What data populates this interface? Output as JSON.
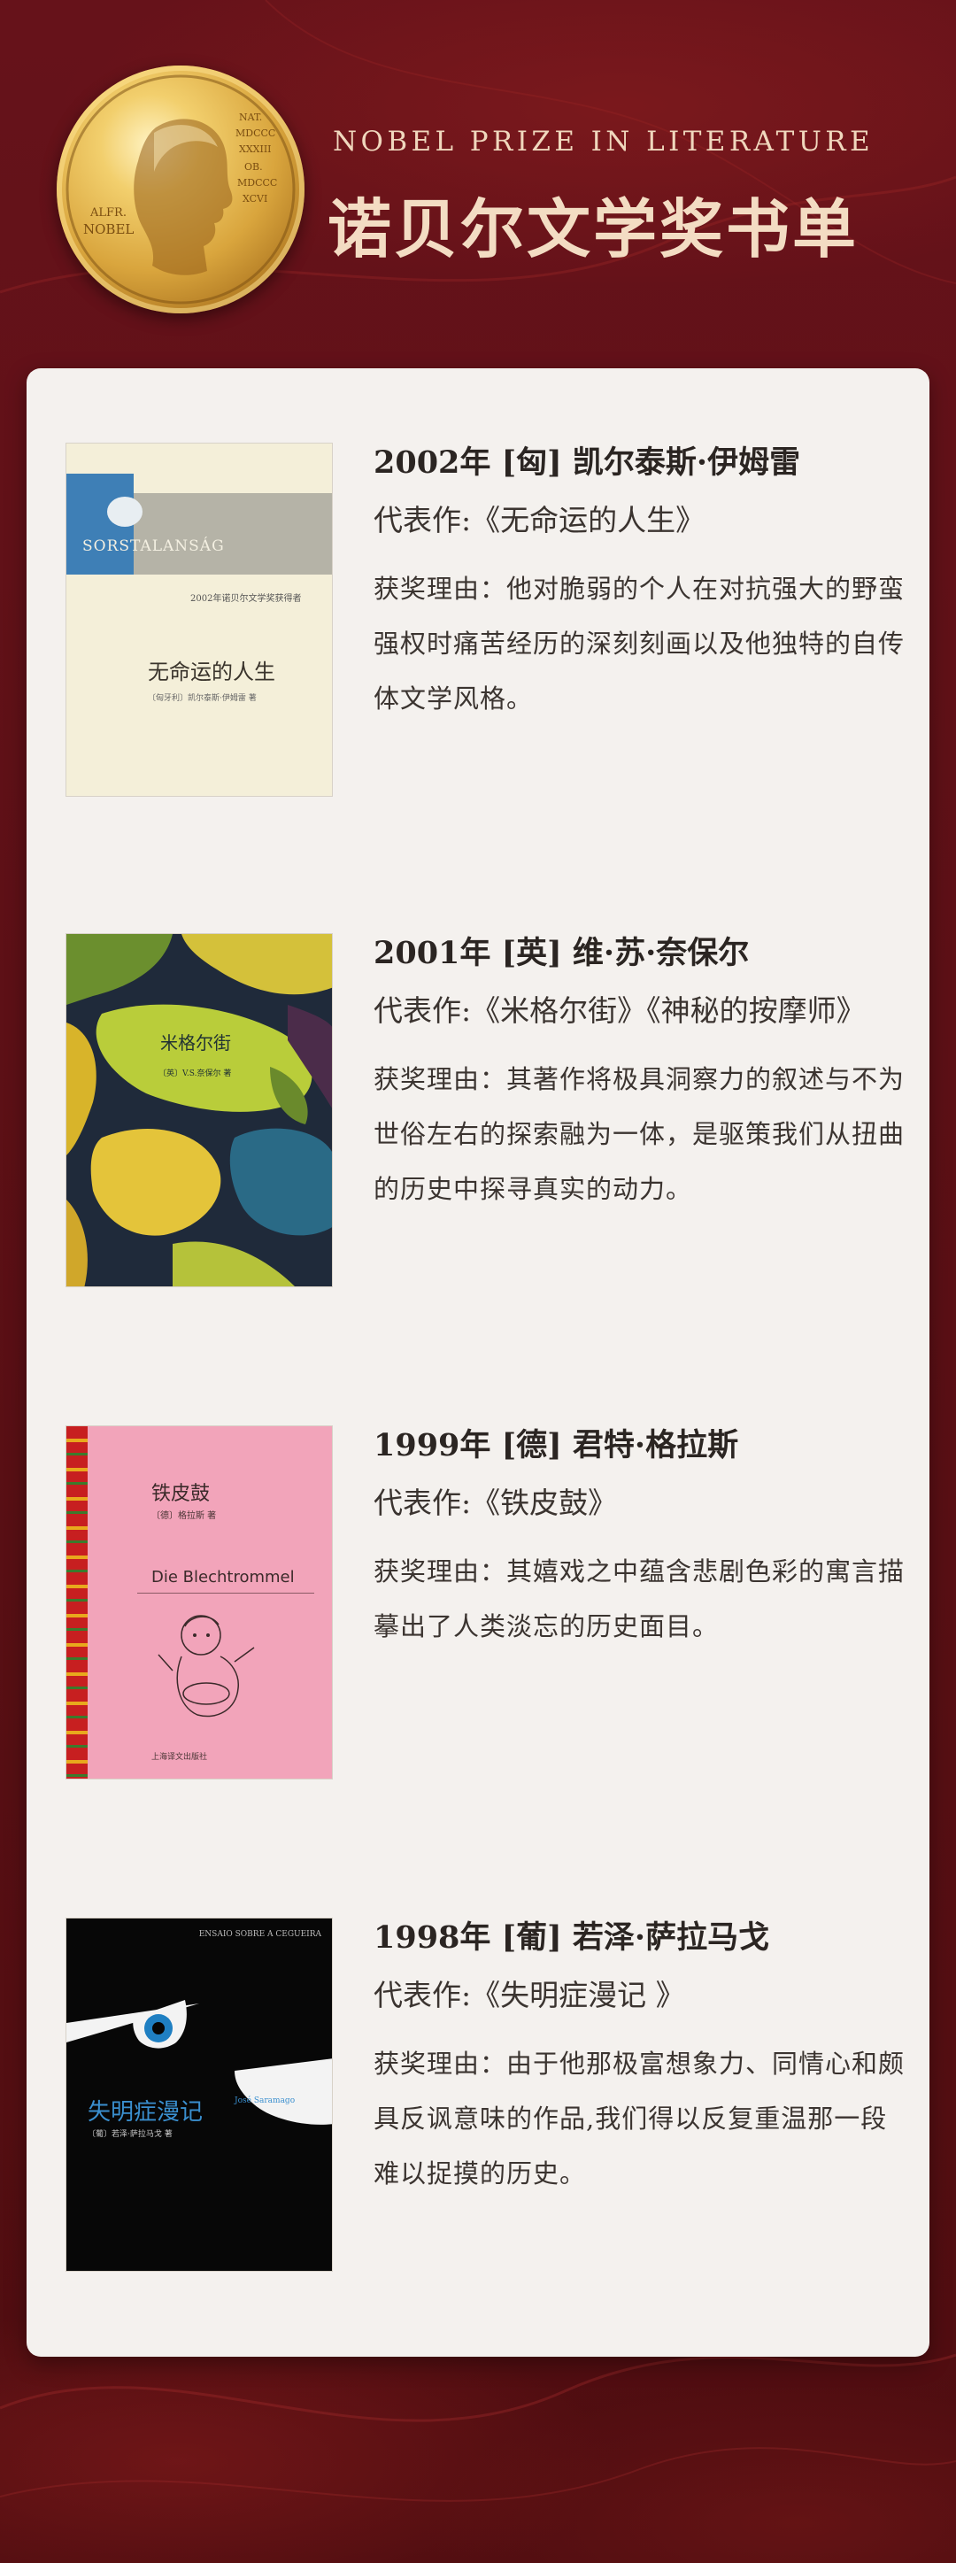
{
  "header": {
    "subtitle_en": "NOBEL PRIZE IN LITERATURE",
    "title_cn": "诺贝尔文学奖书单",
    "medal": {
      "inscription_left_1": "ALFR.",
      "inscription_left_2": "NOBEL",
      "inscription_right_1": "NAT.",
      "inscription_right_2": "MDCCC",
      "inscription_right_3": "XXXIII",
      "inscription_right_4": "OB.",
      "inscription_right_5": "MDCCC",
      "inscription_right_6": "XCVI"
    }
  },
  "entries": [
    {
      "heading": "2002年 [匈] 凯尔泰斯·伊姆雷",
      "work": "代表作:《无命运的人生》",
      "reason": "获奖理由：他对脆弱的个人在对抗强大的野蛮强权时痛苦经历的深刻刻画以及他独特的自传体文学风格。",
      "cover": {
        "title": "无命运的人生",
        "original_title": "SORSTALANSÁG",
        "note": "2002年诺贝尔文学奖获得者",
        "author_line": "〔匈牙利〕凯尔泰斯·伊姆雷 著"
      }
    },
    {
      "heading": "2001年 [英] 维·苏·奈保尔",
      "work": "代表作:《米格尔街》《神秘的按摩师》",
      "reason": "获奖理由：其著作将极具洞察力的叙述与不为世俗左右的探索融为一体，是驱策我们从扭曲的历史中探寻真实的动力。",
      "cover": {
        "title": "米格尔街",
        "author_line": "〔英〕V.S.奈保尔 著"
      }
    },
    {
      "heading": "1999年 [德] 君特·格拉斯",
      "work": "代表作:《铁皮鼓》",
      "reason": "获奖理由：其嬉戏之中蕴含悲剧色彩的寓言描摹出了人类淡忘的历史面目。",
      "cover": {
        "title": "铁皮鼓",
        "original_title": "Die Blechtrommel",
        "author_line": "〔德〕格拉斯 著",
        "publisher": "上海译文出版社"
      }
    },
    {
      "heading": "1998年 [葡] 若泽·萨拉马戈",
      "work": "代表作:《失明症漫记 》",
      "reason": "获奖理由：由于他那极富想象力、同情心和颇具反讽意味的作品,我们得以反复重温那一段难以捉摸的历史。",
      "cover": {
        "title": "失明症漫记",
        "original_title": "ENSAIO SOBRE A CEGUEIRA",
        "author_line": "〔葡〕若泽·萨拉马戈 著",
        "author_en": "José Saramago"
      }
    }
  ],
  "colors": {
    "background": "#5e1012",
    "card": "#f4f1ee",
    "title_gold": "#f3dcc3"
  }
}
